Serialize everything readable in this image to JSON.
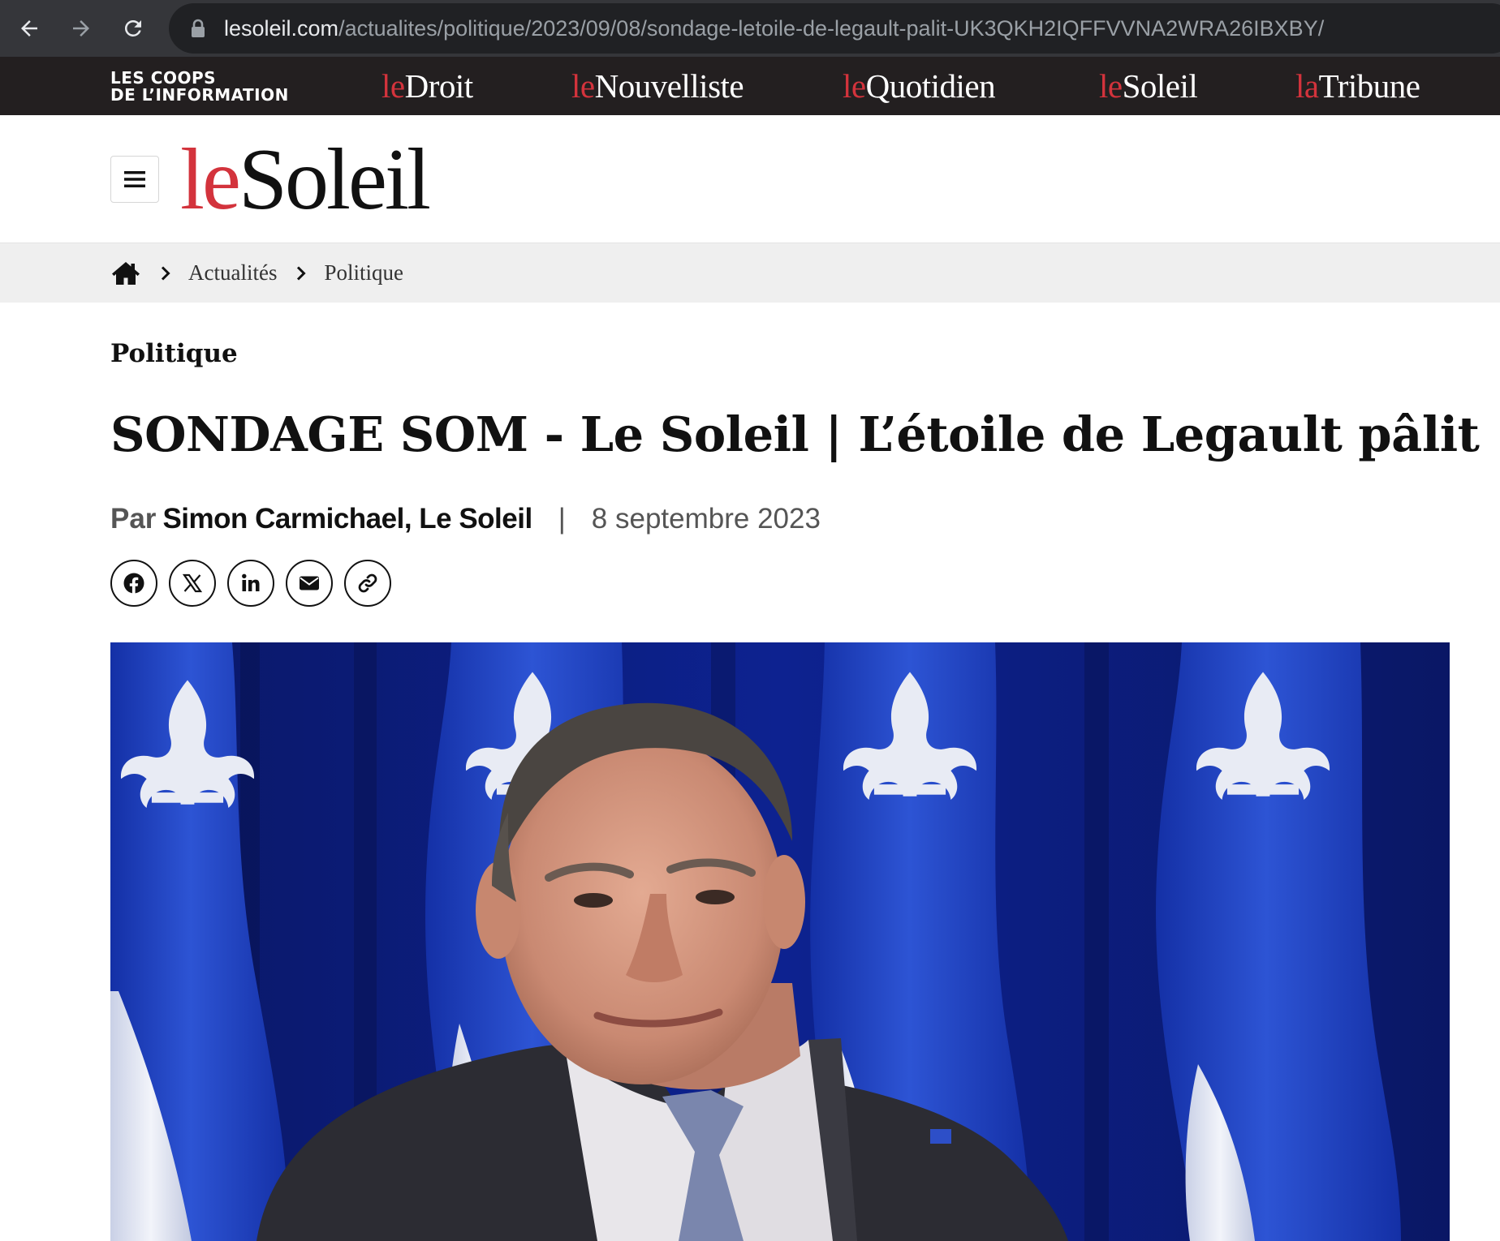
{
  "browser": {
    "url_host": "lesoleil.com",
    "url_path": "/actualites/politique/2023/09/08/sondage-letoile-de-legault-palit-UK3QKH2IQFFVVNA2WRA26IBXBY/"
  },
  "network": {
    "logo_line1": "LES COOPS",
    "logo_line2": "DE L’INFORMATION",
    "links": [
      {
        "prefix": "le",
        "name": "Droit"
      },
      {
        "prefix": "le",
        "name": "Nouvelliste"
      },
      {
        "prefix": "le",
        "name": "Quotidien"
      },
      {
        "prefix": "le",
        "name": "Soleil"
      },
      {
        "prefix": "la",
        "name": "Tribune"
      }
    ]
  },
  "header": {
    "logo_prefix": "le",
    "logo_name": "Soleil"
  },
  "breadcrumb": {
    "items": [
      "Actualités",
      "Politique"
    ]
  },
  "article": {
    "section": "Politique",
    "headline": "SONDAGE SOM - Le Soleil | L’étoile de Legault pâlit",
    "byline_prefix": "Par",
    "author": "Simon Carmichael, Le Soleil",
    "separator": "|",
    "date": "8 septembre 2023"
  },
  "share": {
    "icons": [
      "facebook-icon",
      "x-icon",
      "linkedin-icon",
      "email-icon",
      "link-icon"
    ]
  },
  "colors": {
    "brand_red": "#d3333c",
    "network_bar": "#231f20",
    "browser_bar": "#35363a",
    "breadcrumb_bg": "#efefef",
    "flag_blue": "#1a3fb3"
  }
}
